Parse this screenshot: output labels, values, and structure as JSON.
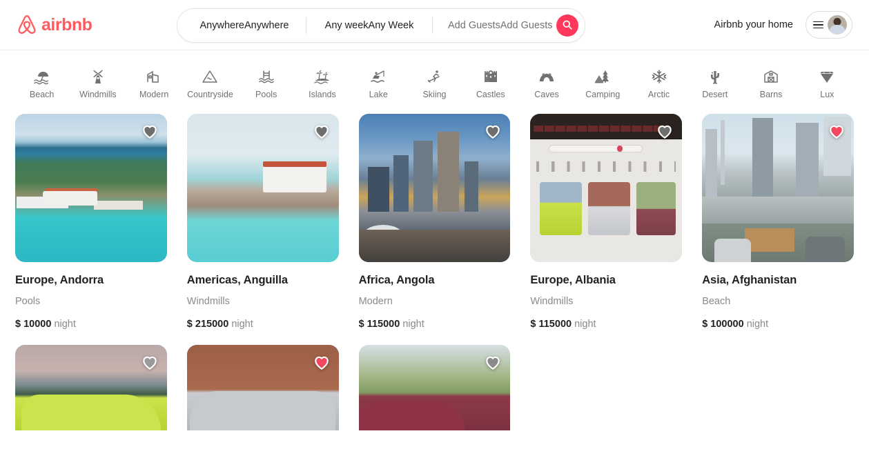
{
  "header": {
    "brand": "airbnb",
    "logo_icon": "airbnb-logo-icon",
    "host_link": "Airbnb your home",
    "menu_icon": "hamburger-menu-icon",
    "avatar_icon": "user-avatar",
    "accent_color": "#FF5A5F",
    "search_button_color": "#FF385C"
  },
  "search": {
    "location": "AnywhereAnywhere",
    "dates": "Any weekAny Week",
    "guests": "Add GuestsAdd Guests",
    "search_icon": "search-icon"
  },
  "categories": [
    {
      "label": "Beach",
      "icon": "beach-umbrella-icon"
    },
    {
      "label": "Windmills",
      "icon": "windmill-icon"
    },
    {
      "label": "Modern",
      "icon": "modern-building-icon"
    },
    {
      "label": "Countryside",
      "icon": "mountain-icon"
    },
    {
      "label": "Pools",
      "icon": "pool-ladder-icon"
    },
    {
      "label": "Islands",
      "icon": "palm-island-icon"
    },
    {
      "label": "Lake",
      "icon": "fishing-boat-icon"
    },
    {
      "label": "Skiing",
      "icon": "skier-icon"
    },
    {
      "label": "Castles",
      "icon": "castle-icon"
    },
    {
      "label": "Caves",
      "icon": "cave-icon"
    },
    {
      "label": "Camping",
      "icon": "tent-tree-icon"
    },
    {
      "label": "Arctic",
      "icon": "snowflake-icon"
    },
    {
      "label": "Desert",
      "icon": "cactus-icon"
    },
    {
      "label": "Barns",
      "icon": "barn-icon"
    },
    {
      "label": "Lux",
      "icon": "diamond-icon"
    }
  ],
  "listings": [
    {
      "title": "Europe, Andorra",
      "category": "Pools",
      "price_amount": "$ 10000",
      "price_unit": "night",
      "favorited": false,
      "image": "aerial-coastline-resort"
    },
    {
      "title": "Americas, Anguilla",
      "category": "Windmills",
      "price_amount": "$ 215000",
      "price_unit": "night",
      "favorited": false,
      "image": "caribbean-beach-villa"
    },
    {
      "title": "Africa, Angola",
      "category": "Modern",
      "price_amount": "$ 115000",
      "price_unit": "night",
      "favorited": false,
      "image": "city-skyline-dusk"
    },
    {
      "title": "Europe, Albania",
      "category": "Windmills",
      "price_amount": "$ 115000",
      "price_unit": "night",
      "favorited": false,
      "image": "laptop-screen-photo"
    },
    {
      "title": "Asia, Afghanistan",
      "category": "Beach",
      "price_amount": "$ 100000",
      "price_unit": "night",
      "favorited": true,
      "image": "dubai-balcony-view"
    }
  ],
  "listings_row2": [
    {
      "favorited": false,
      "image": "yellow-car"
    },
    {
      "favorited": true,
      "image": "silver-suv"
    },
    {
      "favorited": false,
      "image": "red-car-palms"
    }
  ],
  "colors": {
    "heart_active": "#F2475E",
    "heart_inactive": "#717171",
    "text_primary": "#222222",
    "text_muted": "#8a8a8a"
  }
}
